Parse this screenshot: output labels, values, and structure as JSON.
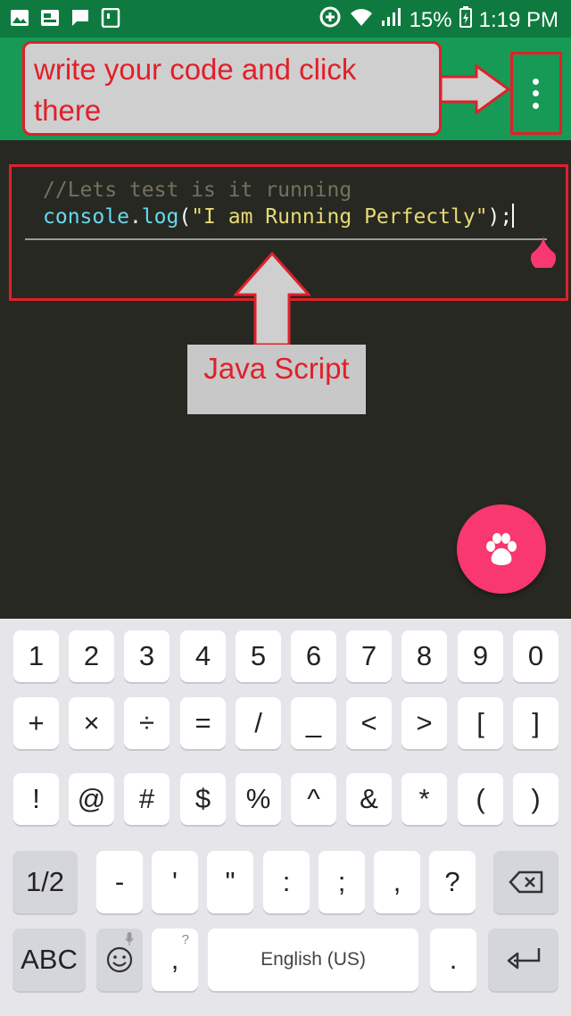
{
  "status_bar": {
    "battery": "15%",
    "time": "1:19 PM",
    "left_icons": [
      "gallery-icon",
      "screen-icon",
      "message-icon",
      "terminal-icon"
    ],
    "right_icons": [
      "data-saver-icon",
      "wifi-icon",
      "signal-icon",
      "battery-icon"
    ]
  },
  "annotations": {
    "toolbar_callout": "write your code and click there",
    "editor_label": "Java Script"
  },
  "editor": {
    "comment_line": "//Lets test is it running",
    "code_object": "console",
    "code_dot": ".",
    "code_method": "log",
    "code_open": "(",
    "code_string": "\"I am Running Perfectly\"",
    "code_close": ");"
  },
  "keyboard": {
    "row1": [
      "1",
      "2",
      "3",
      "4",
      "5",
      "6",
      "7",
      "8",
      "9",
      "0"
    ],
    "row2": [
      "+",
      "×",
      "÷",
      "=",
      "/",
      "_",
      "<",
      ">",
      "[",
      "]"
    ],
    "row3": [
      "!",
      "@",
      "#",
      "$",
      "%",
      "^",
      "&",
      "*",
      "(",
      ")"
    ],
    "row4": [
      "-",
      "'",
      "\"",
      ":",
      ";",
      ",",
      "?"
    ],
    "shift_label": "1/2",
    "abc_label": "ABC",
    "comma_label": ",",
    "comma_hint": "?",
    "space_label": "English (US)",
    "period_label": "."
  },
  "colors": {
    "statusbar": "#0f7a3f",
    "toolbar": "#169a55",
    "editor_bg": "#272822",
    "annotation_red": "#e0202a",
    "fab": "#f8386e"
  }
}
